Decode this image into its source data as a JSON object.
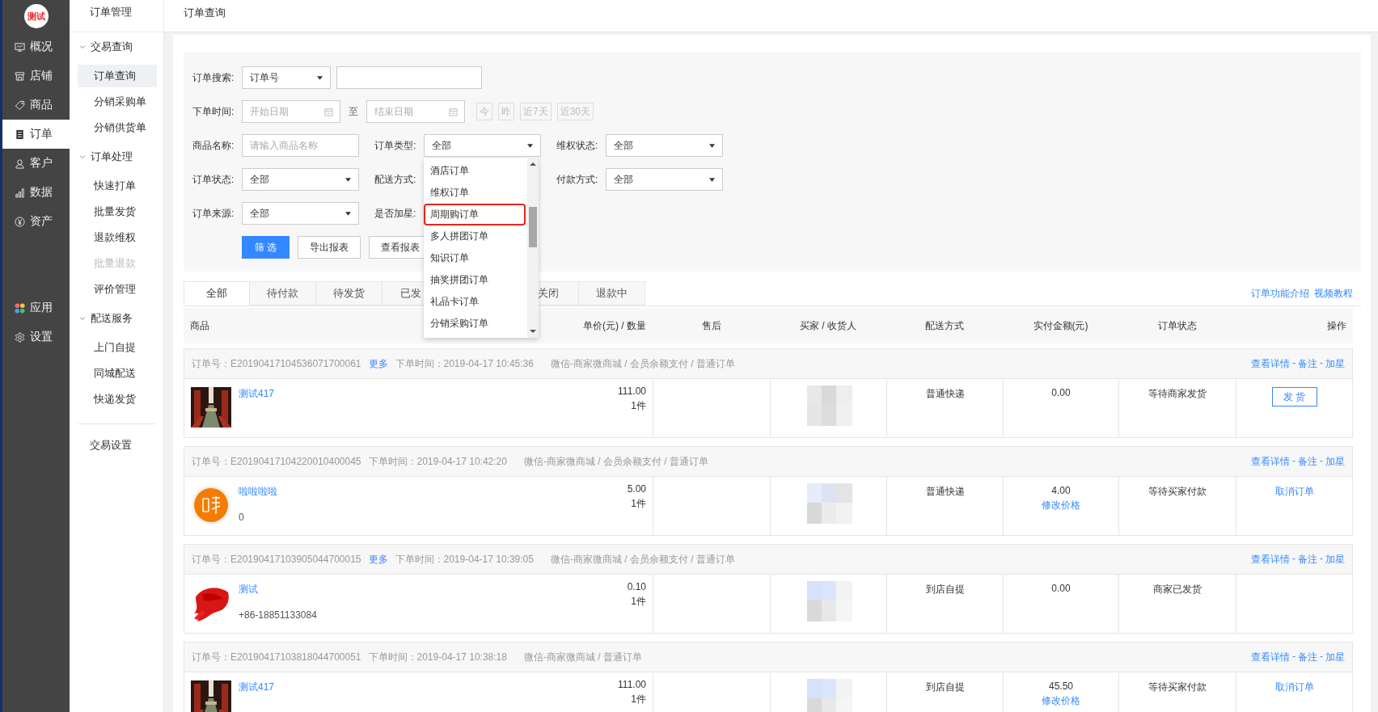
{
  "logo": {
    "text": "测试"
  },
  "main_nav": [
    {
      "label": "概况",
      "selected": false
    },
    {
      "label": "店铺",
      "selected": false
    },
    {
      "label": "商品",
      "selected": false
    },
    {
      "label": "订单",
      "selected": true
    },
    {
      "label": "客户",
      "selected": false
    },
    {
      "label": "数据",
      "selected": false
    },
    {
      "label": "资产",
      "selected": false
    }
  ],
  "main_nav_bottom": [
    {
      "label": "应用",
      "selected": false
    },
    {
      "label": "设置",
      "selected": false
    }
  ],
  "sub_nav": {
    "title": "订单管理",
    "groups": [
      {
        "label": "交易查询",
        "expanded": true,
        "children": [
          {
            "label": "订单查询",
            "selected": true,
            "disabled": false
          },
          {
            "label": "分销采购单",
            "selected": false,
            "disabled": false
          },
          {
            "label": "分销供货单",
            "selected": false,
            "disabled": false
          }
        ]
      },
      {
        "label": "订单处理",
        "expanded": true,
        "children": [
          {
            "label": "快速打单",
            "selected": false,
            "disabled": false
          },
          {
            "label": "批量发货",
            "selected": false,
            "disabled": false
          },
          {
            "label": "退款维权",
            "selected": false,
            "disabled": false
          },
          {
            "label": "批量退款",
            "selected": false,
            "disabled": true
          },
          {
            "label": "评价管理",
            "selected": false,
            "disabled": false
          }
        ]
      },
      {
        "label": "配送服务",
        "expanded": true,
        "children": [
          {
            "label": "上门自提",
            "selected": false,
            "disabled": false
          },
          {
            "label": "同城配送",
            "selected": false,
            "disabled": false
          },
          {
            "label": "快递发货",
            "selected": false,
            "disabled": false
          }
        ]
      }
    ],
    "footer": "交易设置"
  },
  "page_title": "订单查询",
  "filters": {
    "order_search": {
      "label": "订单搜索:",
      "type_value": "订单号"
    },
    "order_time": {
      "label": "下单时间:",
      "start_placeholder": "开始日期",
      "separator": "至",
      "end_placeholder": "结束日期",
      "quick": [
        "今",
        "昨",
        "近7天",
        "近30天"
      ]
    },
    "fields": [
      {
        "label": "商品名称:",
        "kind": "input",
        "placeholder": "请输入商品名称"
      },
      {
        "label": "订单类型:",
        "kind": "select",
        "value": "全部",
        "options": [
          {
            "label": "酒店订单",
            "highlighted": false
          },
          {
            "label": "维权订单",
            "highlighted": false
          },
          {
            "label": "周期购订单",
            "highlighted": true
          },
          {
            "label": "多人拼团订单",
            "highlighted": false
          },
          {
            "label": "知识订单",
            "highlighted": false
          },
          {
            "label": "抽奖拼团订单",
            "highlighted": false
          },
          {
            "label": "礼品卡订单",
            "highlighted": false
          },
          {
            "label": "分销采购订单",
            "highlighted": false
          }
        ]
      },
      {
        "label": "维权状态:",
        "kind": "select",
        "value": "全部"
      },
      {
        "label": "订单状态:",
        "kind": "select",
        "value": "全部"
      },
      {
        "label": "配送方式:",
        "kind": "select"
      },
      {
        "label": "付款方式:",
        "kind": "select",
        "value": "全部"
      },
      {
        "label": "订单来源:",
        "kind": "select",
        "value": "全部"
      },
      {
        "label": "是否加星:",
        "kind": "select"
      }
    ],
    "buttons": [
      {
        "label": "筛 选",
        "kind": "primary"
      },
      {
        "label": "导出报表",
        "kind": "default"
      },
      {
        "label": "查看报表",
        "kind": "default"
      }
    ]
  },
  "tabs": [
    {
      "label": "全部",
      "selected": true
    },
    {
      "label": "待付款",
      "selected": false
    },
    {
      "label": "待发货",
      "selected": false
    },
    {
      "label": "已发",
      "selected": false
    },
    {
      "label": "关闭",
      "selected": false
    },
    {
      "label": "退款中",
      "selected": false
    }
  ],
  "help_links": [
    "订单功能介绍",
    "视频教程"
  ],
  "table": {
    "columns": [
      "商品",
      "单价(元) / 数量",
      "售后",
      "买家 / 收货人",
      "配送方式",
      "实付金额(元)",
      "订单状态",
      "操作"
    ]
  },
  "action_separator": "-",
  "orders": [
    {
      "number": "订单号：E20190417104536071700061",
      "more_link": "更多",
      "time": "下单时间：2019-04-17 10:45:36",
      "source": "微信-商家微商城 / 会员余额支付 / 普通订单",
      "actions": [
        "查看详情",
        "备注",
        "加星"
      ],
      "image": {
        "kind": "picture"
      },
      "product_name": "测试417",
      "price": "111.00",
      "quantity": "1件",
      "delivery": "普通快递",
      "paid": "0.00",
      "status": "等待商家发货",
      "operation": {
        "kind": "button",
        "label": "发 货"
      }
    },
    {
      "number": "订单号：E20190417104220010400045",
      "time": "下单时间：2019-04-17 10:42:20",
      "source": "微信-商家微商城 / 会员余额支付 / 普通订单",
      "actions": [
        "查看详情",
        "备注",
        "加星"
      ],
      "image": {
        "kind": "picture"
      },
      "product_name": "啦啦啦啦",
      "product_note": "0",
      "price": "5.00",
      "quantity": "1件",
      "delivery": "普通快递",
      "paid": "4.00",
      "price_link": "修改价格",
      "status": "等待买家付款",
      "operation": {
        "kind": "link",
        "label": "取消订单"
      }
    },
    {
      "number": "订单号：E20190417103905044700015",
      "more_link": "更多",
      "time": "下单时间：2019-04-17 10:39:05",
      "source": "微信-商家微商城 / 会员余额支付 / 普通订单",
      "actions": [
        "查看详情",
        "备注",
        "加星"
      ],
      "image": {
        "kind": "picture"
      },
      "product_name": "测试",
      "product_note": "+86-18851133084",
      "price": "0.10",
      "quantity": "1件",
      "delivery": "到店自提",
      "paid": "0.00",
      "status": "商家已发货"
    },
    {
      "number": "订单号：E20190417103818044700051",
      "time": "下单时间：2019-04-17 10:38:18",
      "source": "微信-商家微商城 / 普通订单",
      "actions": [
        "查看详情",
        "备注",
        "加星"
      ],
      "image": {
        "kind": "picture"
      },
      "product_name": "测试417",
      "price": "111.00",
      "quantity": "1件",
      "delivery": "到店自提",
      "paid": "45.50",
      "price_link": "修改价格",
      "status": "等待买家付款",
      "operation": {
        "kind": "link",
        "label": "取消订单"
      }
    }
  ]
}
